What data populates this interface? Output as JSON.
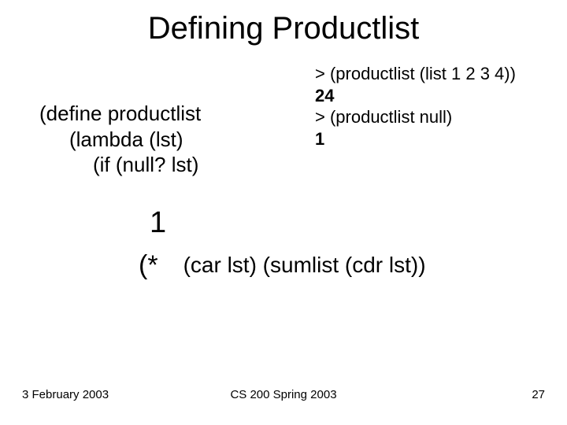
{
  "title": "Defining Productlist",
  "code": {
    "line1": "(define productlist",
    "line2": "(lambda (lst)",
    "line3": "(if (null? lst)"
  },
  "repl": {
    "line1": "> (productlist (list 1 2 3 4))",
    "line2": "24",
    "line3": "> (productlist null)",
    "line4": "1"
  },
  "one": "1",
  "star_open": "(*",
  "star_rest": "(car lst) (sumlist (cdr lst))",
  "footer": {
    "left": "3 February 2003",
    "center": "CS 200 Spring 2003",
    "right": "27"
  }
}
